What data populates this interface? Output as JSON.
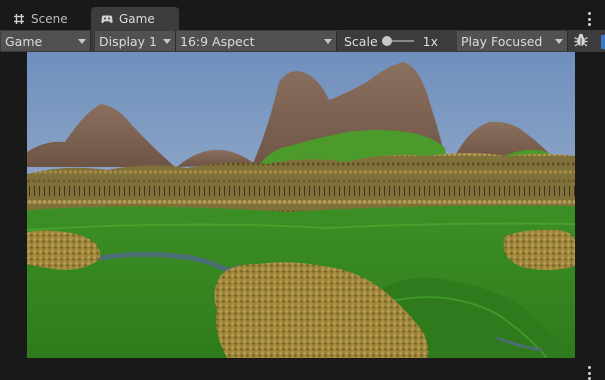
{
  "tabs": [
    {
      "label": "Scene",
      "icon": "hash-grid-icon",
      "active": false
    },
    {
      "label": "Game",
      "icon": "gamepad-icon",
      "active": true
    }
  ],
  "toolbar": {
    "display_mode": "Game",
    "display": "Display 1",
    "aspect": "16:9 Aspect",
    "scale_label": "Scale",
    "scale_value": "1x",
    "scale_level": 0.0,
    "play_mode": "Play Focused",
    "stats_icon": "bug-icon"
  },
  "viewport": {
    "description_icon": "game-view",
    "sky_color_top": "#6f8fbd",
    "sky_color_bottom": "#b3c1d3",
    "grass_color": "#3f8f25",
    "mountain_color": "#7a5f4c",
    "foliage_color": "#a08a3d"
  },
  "colors": {
    "background": "#191919",
    "panel": "#3c3c3c",
    "dropdown": "#515151",
    "accent": "#3a79c4"
  }
}
